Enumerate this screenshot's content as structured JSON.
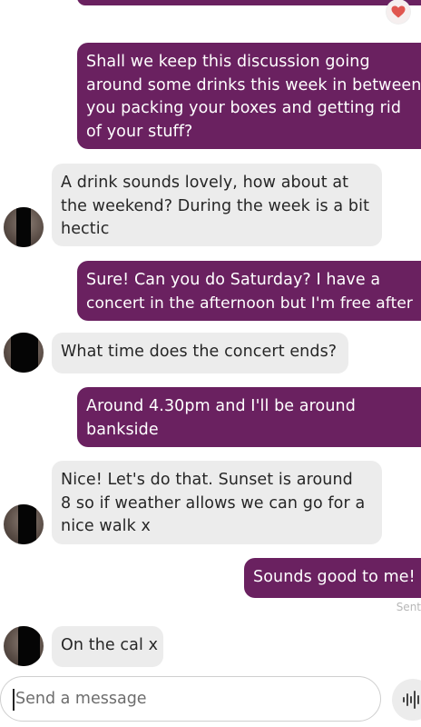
{
  "messages": [
    {
      "from": "me",
      "lines": [
        "Shall we keep this discussion going",
        "around some drinks this week in between",
        "you packing your boxes and getting rid",
        "of your stuff?"
      ]
    },
    {
      "from": "them",
      "lines": [
        "A drink sounds lovely, how about at",
        "the weekend? During the week is a bit",
        "hectic"
      ]
    },
    {
      "from": "me",
      "lines": [
        "Sure! Can you do Saturday? I have a",
        "concert in the afternoon but I'm free after"
      ]
    },
    {
      "from": "them",
      "lines": [
        "What time does the concert ends?"
      ]
    },
    {
      "from": "me",
      "lines": [
        "Around 4.30pm and I'll be around",
        "bankside"
      ]
    },
    {
      "from": "them",
      "lines": [
        "Nice! Let's do that. Sunset is around",
        "8 so if weather allows we can go for a",
        "nice walk x"
      ]
    },
    {
      "from": "me",
      "lines": [
        "Sounds good to me!"
      ]
    },
    {
      "from": "them",
      "lines": [
        "On the cal x"
      ]
    }
  ],
  "status": {
    "label": "Sent"
  },
  "reaction": {
    "icon": "heart-icon",
    "color": "#e0564f"
  },
  "composer": {
    "placeholder": "Send a message"
  },
  "mic": {
    "icon": "voice-waveform-icon"
  },
  "colors": {
    "sent_bubble": "#6a2160",
    "received_bubble": "#ececec",
    "accent": "#e0564f"
  }
}
